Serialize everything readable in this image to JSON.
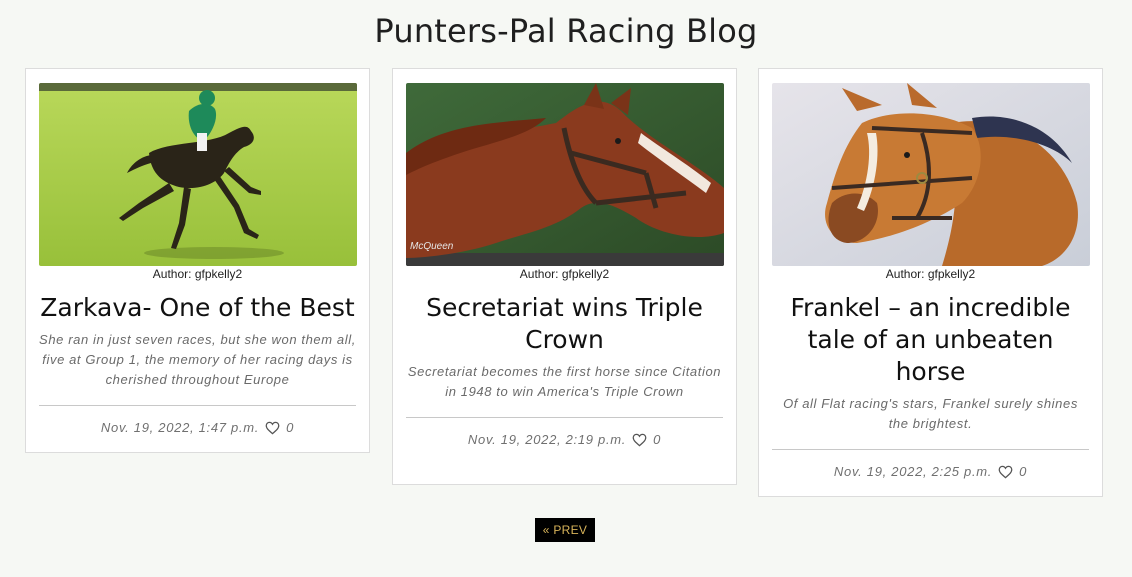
{
  "blog": {
    "title": "Punters-Pal Racing Blog"
  },
  "posts": [
    {
      "author": "Author: gfpkelly2",
      "title": "Zarkava- One of the Best",
      "excerpt": "She ran in just seven races, but she won them all, five at Group 1, the memory of her racing days is cherished throughout Europe",
      "date": "Nov. 19, 2022, 1:47 p.m.",
      "likes": "0"
    },
    {
      "author": "Author: gfpkelly2",
      "title": "Secretariat wins Triple Crown",
      "excerpt": "Secretariat becomes the first horse since Citation in 1948 to win America's Triple Crown",
      "date": "Nov. 19, 2022, 2:19 p.m.",
      "likes": "0",
      "image_watermark": "McQueen"
    },
    {
      "author": "Author: gfpkelly2",
      "title": "Frankel – an incredible tale of an unbeaten horse",
      "excerpt": "Of all Flat racing's stars, Frankel surely shines the brightest.",
      "date": "Nov. 19, 2022, 2:25 p.m.",
      "likes": "0"
    }
  ],
  "pagination": {
    "prev_label": "« PREV"
  },
  "icons": {
    "like": "heart-outline-icon"
  },
  "colors": {
    "page_bg": "#f6f8f4",
    "button_bg": "#000000",
    "button_text": "#d8b45a",
    "muted_text": "#6a6a6a"
  }
}
